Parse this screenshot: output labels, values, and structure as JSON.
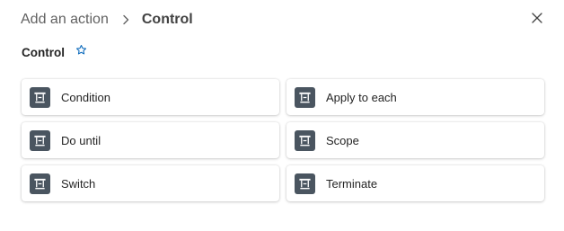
{
  "header": {
    "breadcrumb_root": "Add an action",
    "breadcrumb_current": "Control"
  },
  "section": {
    "title": "Control"
  },
  "actions": [
    {
      "label": "Condition",
      "icon": "control-icon"
    },
    {
      "label": "Apply to each",
      "icon": "control-icon"
    },
    {
      "label": "Do until",
      "icon": "control-icon"
    },
    {
      "label": "Scope",
      "icon": "control-icon"
    },
    {
      "label": "Switch",
      "icon": "control-icon"
    },
    {
      "label": "Terminate",
      "icon": "control-icon"
    }
  ],
  "colors": {
    "icon_bg": "#4a5560",
    "star": "#0f6cbd",
    "text": "#242424",
    "muted": "#616161"
  }
}
